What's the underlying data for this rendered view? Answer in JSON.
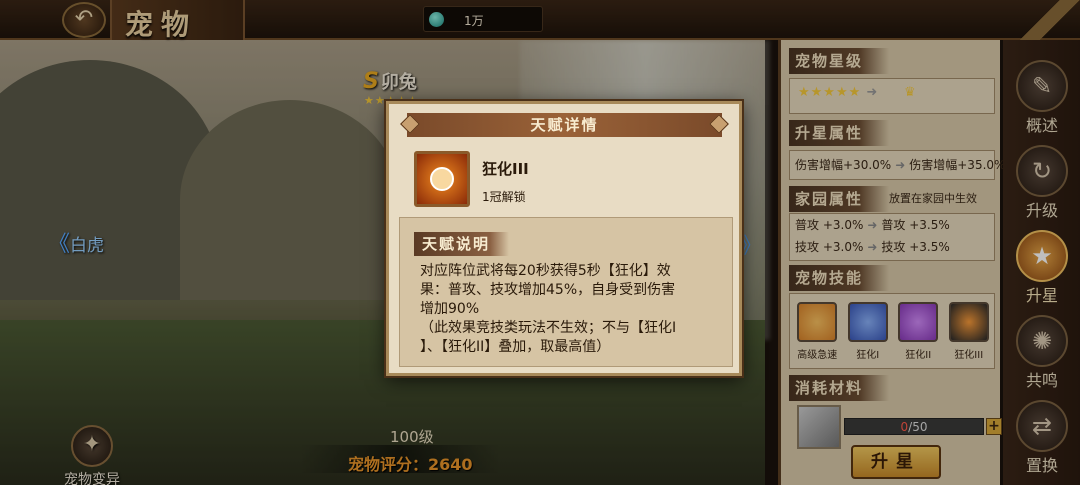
{
  "topbar": {
    "title": "宠物",
    "currency": "1万"
  },
  "pet": {
    "grade": "S",
    "name": "卯兔",
    "stars": "★★★★★"
  },
  "nav": {
    "prev_label": "白虎",
    "prev_arrow": "《",
    "next_arrow": "》"
  },
  "bottom": {
    "level": "100级",
    "score_label": "宠物评分：2640",
    "mutate_label": "宠物变异"
  },
  "panel": {
    "star_title": "宠物星级",
    "stars_current": "★★★★★",
    "stars_arrow": "➜",
    "stars_next": "♛",
    "upstar_title": "升星属性",
    "upstar_from": "伤害增幅+30.0%",
    "upstar_arrow": "➜",
    "upstar_to": "伤害增幅+35.0%",
    "home_title": "家园属性",
    "home_note": "放置在家园中生效",
    "home_rows": [
      {
        "from": "普攻 +3.0%",
        "to": "普攻 +3.5%"
      },
      {
        "from": "技攻 +3.0%",
        "to": "技攻 +3.5%"
      }
    ],
    "skills_title": "宠物技能",
    "skills": [
      {
        "name": "高级急速",
        "color": "#d8822a"
      },
      {
        "name": "狂化I",
        "color": "#3a58b8"
      },
      {
        "name": "狂化II",
        "color": "#8a3ab8"
      },
      {
        "name": "狂化III",
        "color": "#2a2a2a"
      }
    ],
    "material_title": "消耗材料",
    "material_have": "0",
    "material_need": "/50",
    "plus": "+",
    "upgrade_btn": "升星"
  },
  "rightnav": [
    {
      "label": "概述",
      "icon": "✎"
    },
    {
      "label": "升级",
      "icon": "↻"
    },
    {
      "label": "升星",
      "icon": "★"
    },
    {
      "label": "共鸣",
      "icon": "✺"
    },
    {
      "label": "置换",
      "icon": "⇄"
    }
  ],
  "dialog": {
    "title": "天赋详情",
    "talent_name": "狂化III",
    "unlock": "1冠解锁",
    "desc_title": "天赋说明",
    "desc_lines": [
      "对应阵位武将每20秒获得5秒【狂化】效",
      "果：普攻、技攻增加45%，自身受到伤害",
      "增加90%",
      "（此效果竞技类玩法不生效；不与【狂化I",
      "】、【狂化II】叠加，取最高值）"
    ]
  },
  "colors": {
    "accent": "#e8952a",
    "panel_bg": "#d8c8a8",
    "dialog_bg": "#e8dcc4"
  }
}
